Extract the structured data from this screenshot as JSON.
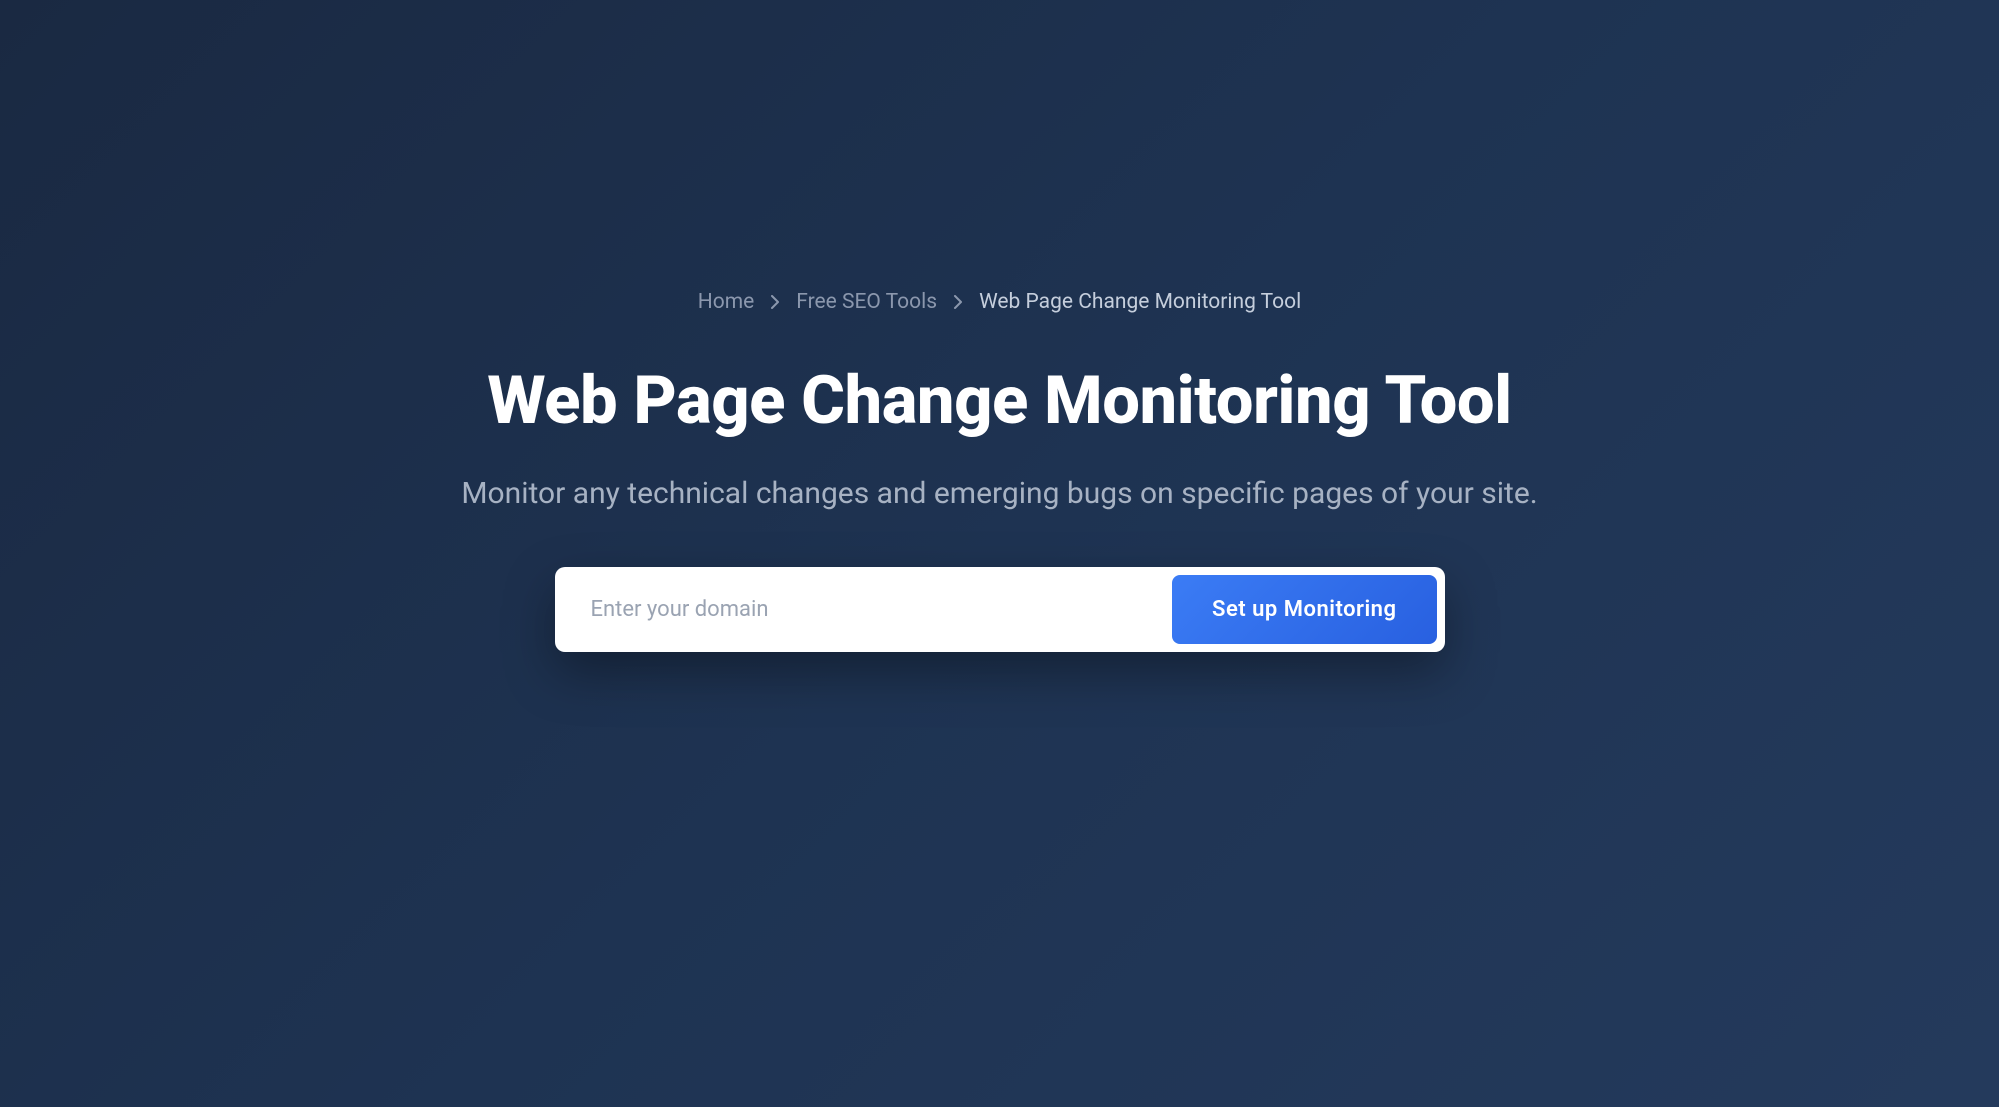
{
  "breadcrumb": {
    "items": [
      {
        "label": "Home",
        "current": false
      },
      {
        "label": "Free SEO Tools",
        "current": false
      },
      {
        "label": "Web Page Change Monitoring Tool",
        "current": true
      }
    ]
  },
  "header": {
    "title": "Web Page Change Monitoring Tool",
    "subtitle": "Monitor any technical changes and emerging bugs on specific pages of your site."
  },
  "form": {
    "domain_placeholder": "Enter your domain",
    "domain_value": "",
    "submit_label": "Set up Monitoring"
  }
}
